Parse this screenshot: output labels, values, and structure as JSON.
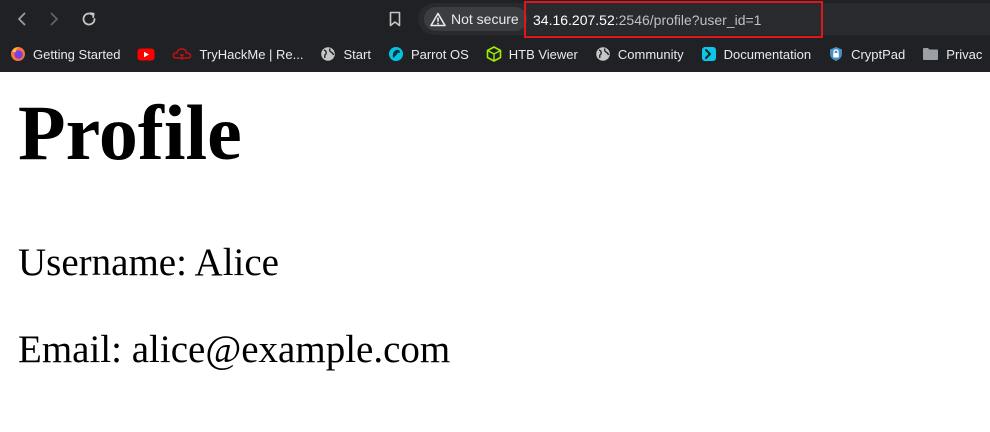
{
  "browser": {
    "security_label": "Not secure",
    "url_host": "34.16.207.52",
    "url_path": ":2546/profile?user_id=1",
    "bookmarks": [
      {
        "label": "Getting Started",
        "icon": "firefox-icon"
      },
      {
        "label": "",
        "icon": "youtube-icon"
      },
      {
        "label": "TryHackMe | Re...",
        "icon": "tryhackme-icon"
      },
      {
        "label": "Start",
        "icon": "globe-icon"
      },
      {
        "label": "Parrot OS",
        "icon": "parrot-icon"
      },
      {
        "label": "HTB Viewer",
        "icon": "htb-icon"
      },
      {
        "label": "Community",
        "icon": "globe-icon"
      },
      {
        "label": "Documentation",
        "icon": "documentation-icon"
      },
      {
        "label": "CryptPad",
        "icon": "cryptpad-icon"
      },
      {
        "label": "Privac",
        "icon": "folder-icon"
      }
    ],
    "colors": {
      "chrome_bg": "#202124",
      "omnibox_bg": "#282a2d",
      "highlight_box": "#e0161b"
    }
  },
  "page": {
    "title": "Profile",
    "username_line": "Username: Alice",
    "email_line": "Email: alice@example.com"
  }
}
